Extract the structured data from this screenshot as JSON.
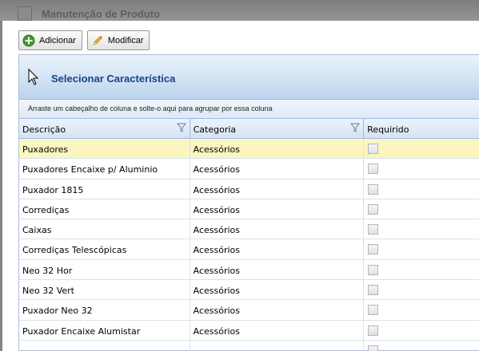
{
  "window": {
    "title": "Manutenção de Produto"
  },
  "toolbar": {
    "add_label": "Adicionar",
    "edit_label": "Modificar"
  },
  "panel": {
    "title": "Selecionar Característica",
    "group_hint": "Arraste um cabeçalho de coluna e solte-o aqui para agrupar por essa coluna"
  },
  "grid": {
    "columns": [
      "Descrição",
      "Categoria",
      "Requirido"
    ],
    "rows": [
      {
        "descricao": "Puxadores",
        "categoria": "Acessórios",
        "requirido": false,
        "selected": true
      },
      {
        "descricao": "Puxadores Encaixe p/ Aluminio",
        "categoria": "Acessórios",
        "requirido": false
      },
      {
        "descricao": "Puxador 1815",
        "categoria": "Acessórios",
        "requirido": false
      },
      {
        "descricao": "Corrediças",
        "categoria": "Acessórios",
        "requirido": false
      },
      {
        "descricao": "Caixas",
        "categoria": "Acessórios",
        "requirido": false
      },
      {
        "descricao": "Corrediças Telescópicas",
        "categoria": "Acessórios",
        "requirido": false
      },
      {
        "descricao": "Neo 32 Hor",
        "categoria": "Acessórios",
        "requirido": false
      },
      {
        "descricao": "Neo 32 Vert",
        "categoria": "Acessórios",
        "requirido": false
      },
      {
        "descricao": "Puxador Neo 32",
        "categoria": "Acessórios",
        "requirido": false
      },
      {
        "descricao": "Puxador Encaixe Alumistar",
        "categoria": "Acessórios",
        "requirido": false
      }
    ]
  },
  "colors": {
    "accent": "#15428b",
    "selected_row": "#fbf5c0",
    "grid_border": "#99bbe8"
  },
  "icons": {
    "add": "plus-circle-icon",
    "edit": "pencil-icon",
    "filter": "filter-funnel-icon",
    "cursor": "pointer-cursor-icon"
  }
}
